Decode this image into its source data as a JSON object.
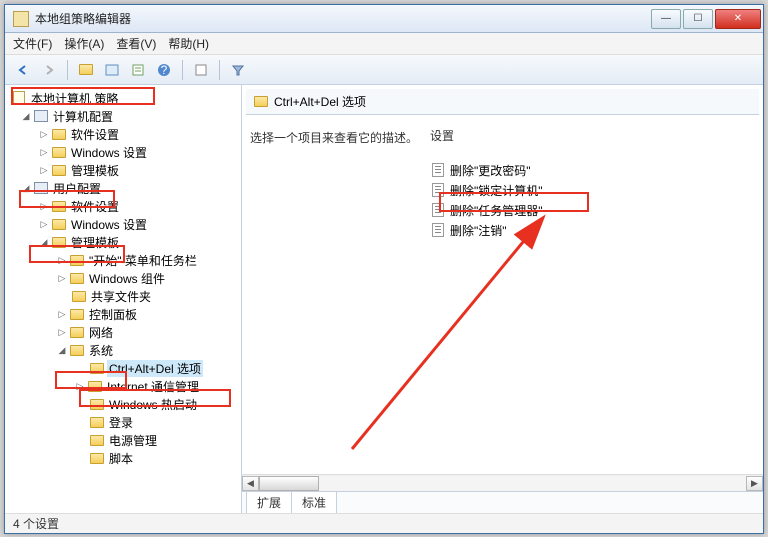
{
  "window": {
    "title": "本地组策略编辑器"
  },
  "menu": {
    "file": "文件(F)",
    "action": "操作(A)",
    "view": "查看(V)",
    "help": "帮助(H)"
  },
  "tree": {
    "root": "本地计算机 策略",
    "computer_config": "计算机配置",
    "software_settings": "软件设置",
    "windows_settings": "Windows 设置",
    "admin_templates": "管理模板",
    "user_config": "用户配置",
    "start_taskbar": "\"开始\" 菜单和任务栏",
    "windows_components": "Windows 组件",
    "shared_folders": "共享文件夹",
    "control_panel": "控制面板",
    "network": "网络",
    "system": "系统",
    "ctrl_alt_del": "Ctrl+Alt+Del 选项",
    "internet_comm": "Internet 通信管理",
    "windows_hotstart": "Windows 热启动",
    "logon": "登录",
    "power_mgmt": "电源管理",
    "scripts": "脚本"
  },
  "right": {
    "header": "Ctrl+Alt+Del 选项",
    "desc": "选择一个项目来查看它的描述。",
    "col_setting": "设置",
    "items": {
      "0": "删除\"更改密码\"",
      "1": "删除\"锁定计算机\"",
      "2": "删除\"任务管理器\"",
      "3": "删除\"注销\""
    },
    "tabs": {
      "extended": "扩展",
      "standard": "标准"
    }
  },
  "status": "4 个设置"
}
